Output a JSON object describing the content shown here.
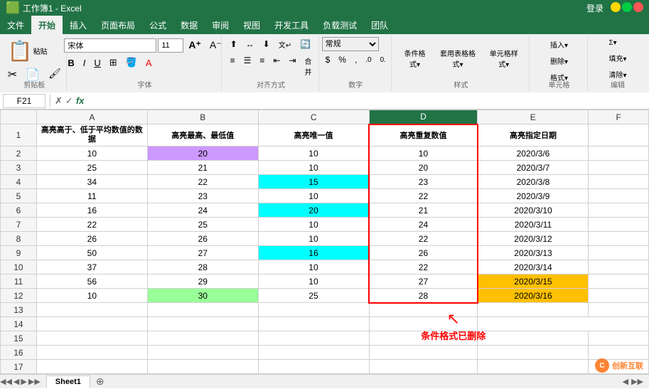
{
  "titlebar": {
    "title": "工作簿1 - Excel",
    "login": "登录"
  },
  "ribbon": {
    "tabs": [
      "文件",
      "开始",
      "插入",
      "页面布局",
      "公式",
      "数据",
      "审阅",
      "视图",
      "开发工具",
      "负载测试",
      "团队"
    ],
    "active_tab": "开始",
    "groups": {
      "clipboard": "剪贴板",
      "font": "字体",
      "alignment": "对齐方式",
      "number": "数字",
      "styles": "样式",
      "cells": "单元格",
      "editing": "编辑"
    },
    "font_name": "宋体",
    "font_size": "11"
  },
  "formula_bar": {
    "cell_ref": "F21",
    "formula": ""
  },
  "headers": {
    "row": "",
    "cols": [
      "A",
      "B",
      "C",
      "D",
      "E",
      "F"
    ]
  },
  "row1": {
    "a": "高亮高于、低于平均数值的数据",
    "b": "高亮最高、最低值",
    "c": "高亮唯一值",
    "d": "高亮重复数值",
    "e": "高亮指定日期"
  },
  "data_rows": [
    {
      "row": "2",
      "a": "10",
      "b": "20",
      "c": "10",
      "d": "10",
      "e": "2020/3/6",
      "b_color": "purple",
      "c_color": "",
      "d_color": ""
    },
    {
      "row": "3",
      "a": "25",
      "b": "21",
      "c": "10",
      "d": "20",
      "e": "2020/3/7",
      "b_color": "",
      "c_color": "",
      "d_color": ""
    },
    {
      "row": "4",
      "a": "34",
      "b": "22",
      "c": "15",
      "d": "23",
      "e": "2020/3/8",
      "b_color": "",
      "c_color": "cyan",
      "d_color": ""
    },
    {
      "row": "5",
      "a": "11",
      "b": "23",
      "c": "10",
      "d": "22",
      "e": "2020/3/9",
      "b_color": "",
      "c_color": "",
      "d_color": ""
    },
    {
      "row": "6",
      "a": "16",
      "b": "24",
      "c": "20",
      "d": "21",
      "e": "2020/3/10",
      "b_color": "",
      "c_color": "cyan",
      "d_color": ""
    },
    {
      "row": "7",
      "a": "22",
      "b": "25",
      "c": "10",
      "d": "24",
      "e": "2020/3/11",
      "b_color": "",
      "c_color": "",
      "d_color": ""
    },
    {
      "row": "8",
      "a": "26",
      "b": "26",
      "c": "10",
      "d": "22",
      "e": "2020/3/12",
      "b_color": "",
      "c_color": "",
      "d_color": ""
    },
    {
      "row": "9",
      "a": "50",
      "b": "27",
      "c": "16",
      "d": "26",
      "e": "2020/3/13",
      "b_color": "",
      "c_color": "cyan",
      "d_color": ""
    },
    {
      "row": "10",
      "a": "37",
      "b": "28",
      "c": "10",
      "d": "22",
      "e": "2020/3/14",
      "b_color": "",
      "c_color": "",
      "d_color": ""
    },
    {
      "row": "11",
      "a": "56",
      "b": "29",
      "c": "10",
      "d": "27",
      "e": "2020/3/15",
      "b_color": "",
      "c_color": "",
      "d_color": "orange",
      "e_color": "orange"
    },
    {
      "row": "12",
      "a": "10",
      "b": "30",
      "c": "25",
      "d": "28",
      "e": "2020/3/16",
      "b_color": "green",
      "c_color": "",
      "d_color": "",
      "e_color": "orange"
    }
  ],
  "empty_rows": [
    "13",
    "14",
    "15",
    "16",
    "17"
  ],
  "annotation": {
    "text": "条件格式已删除",
    "arrow": "←"
  },
  "sheet_tabs": [
    "Sheet1"
  ],
  "status": {
    "left": "",
    "right": ""
  },
  "watermark": "创新互联"
}
